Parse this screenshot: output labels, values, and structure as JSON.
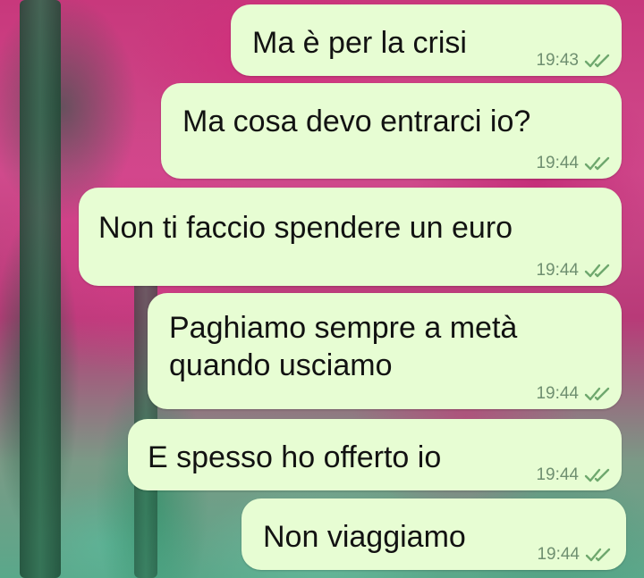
{
  "chat": {
    "messages": [
      {
        "text": "Ma è per la crisi",
        "time": "19:43",
        "status": "read-double-tick"
      },
      {
        "text": "Ma cosa devo entrarci io?",
        "time": "19:44",
        "status": "read-double-tick"
      },
      {
        "text": "Non ti faccio spendere un euro",
        "time": "19:44",
        "status": "read-double-tick"
      },
      {
        "text": "Paghiamo sempre a metà\nquando usciamo",
        "time": "19:44",
        "status": "read-double-tick"
      },
      {
        "text": "E spesso ho offerto io",
        "time": "19:44",
        "status": "read-double-tick"
      },
      {
        "text": "Non viaggiamo",
        "time": "19:44",
        "status": "read-double-tick"
      }
    ]
  },
  "colors": {
    "bubble_outgoing": "#e7fdd3",
    "timestamp": "#6f8f70",
    "tick": "#6fa86e"
  },
  "icons": {
    "tick": "double-check-icon"
  }
}
